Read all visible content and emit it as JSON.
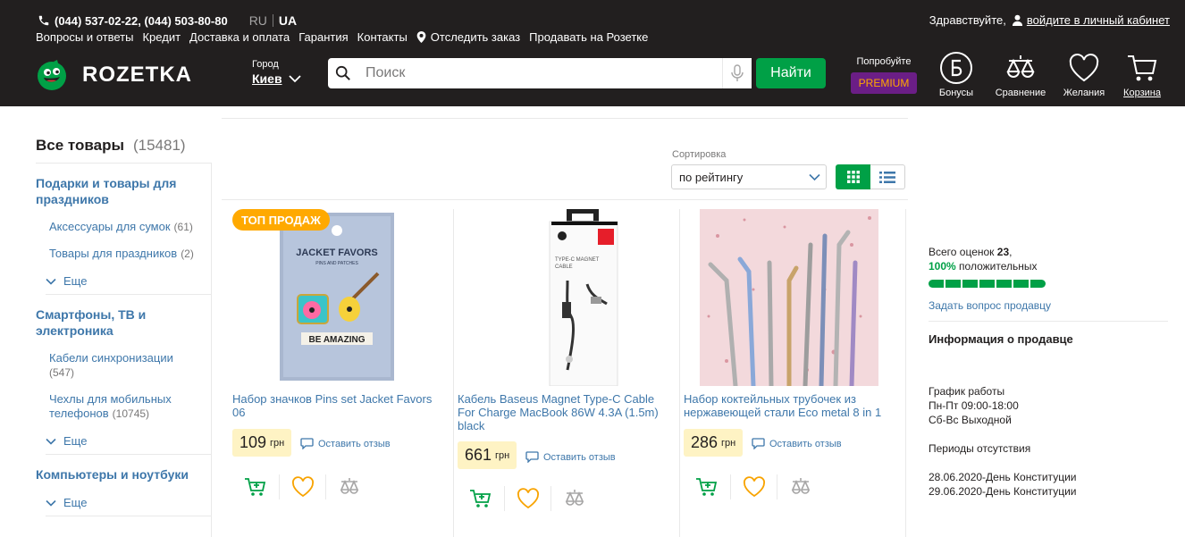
{
  "header": {
    "phones": "(044) 537-02-22, (044) 503-80-80",
    "lang_ru": "RU",
    "lang_ua": "UA",
    "nav": [
      "Вопросы и ответы",
      "Кредит",
      "Доставка и оплата",
      "Гарантия",
      "Контакты",
      "Отследить заказ",
      "Продавать на Розетке"
    ],
    "greeting": "Здравствуйте,",
    "login": "войдите в личный кабинет",
    "logo": "ROZETKA",
    "city_caption": "Город",
    "city": "Киев",
    "search_placeholder": "Поиск",
    "search_button": "Найти",
    "promo_caption": "Попробуйте",
    "promo_label": "PREMIUM",
    "icons": {
      "bonus": "Бонусы",
      "compare": "Сравнение",
      "wishlist": "Желания",
      "cart": "Корзина"
    },
    "colors": {
      "bg": "#221f1f",
      "accent": "#00a046",
      "premium": "#6b1e86"
    }
  },
  "sidebar": {
    "all_label": "Все товары",
    "all_count": "(15481)",
    "categories": [
      {
        "title": "Подарки и товары для праздников",
        "items": [
          {
            "label": "Аксессуары для сумок",
            "count": "(61)"
          },
          {
            "label": "Товары для праздников",
            "count": "(2)"
          }
        ],
        "more": "Еще"
      },
      {
        "title": "Смартфоны, ТВ и электроника",
        "items": [
          {
            "label": "Кабели синхронизации",
            "count": "(547)"
          },
          {
            "label": "Чехлы для мобильных телефонов",
            "count": "(10745)"
          }
        ],
        "more": "Еще"
      },
      {
        "title": "Компьютеры и ноутбуки",
        "items": [],
        "more": "Еще"
      }
    ]
  },
  "sort": {
    "caption": "Сортировка",
    "value": "по рейтингу"
  },
  "products": [
    {
      "badge": "ТОП ПРОДАЖ",
      "title": "Набор значков Pins set Jacket Favors 06",
      "price": "109",
      "currency": "грн",
      "review": "Оставить отзыв"
    },
    {
      "title": "Кабель Baseus Magnet Type-C Cable For Charge MacBook 86W 4.3A (1.5m) black",
      "price": "661",
      "currency": "грн",
      "review": "Оставить отзыв"
    },
    {
      "title": "Набор коктейльных трубочек из нержавеющей стали Eco metal 8 in 1",
      "price": "286",
      "currency": "грн",
      "review": "Оставить отзыв"
    }
  ],
  "seller": {
    "ratings_prefix": "Всего оценок",
    "ratings_count": "23",
    "positive_pct": "100%",
    "positive_label": "положительных",
    "positive_fraction": 1.0,
    "ask": "Задать вопрос продавцу",
    "info_title": "Информация о продавце",
    "schedule_title": "График работы",
    "schedule_1": "Пн-Пт 09:00-18:00",
    "schedule_2": "Сб-Вс Выходной",
    "absence_title": "Периоды отсутствия",
    "absence_1": "28.06.2020-День Конституции",
    "absence_2": "29.06.2020-День Конституции"
  }
}
